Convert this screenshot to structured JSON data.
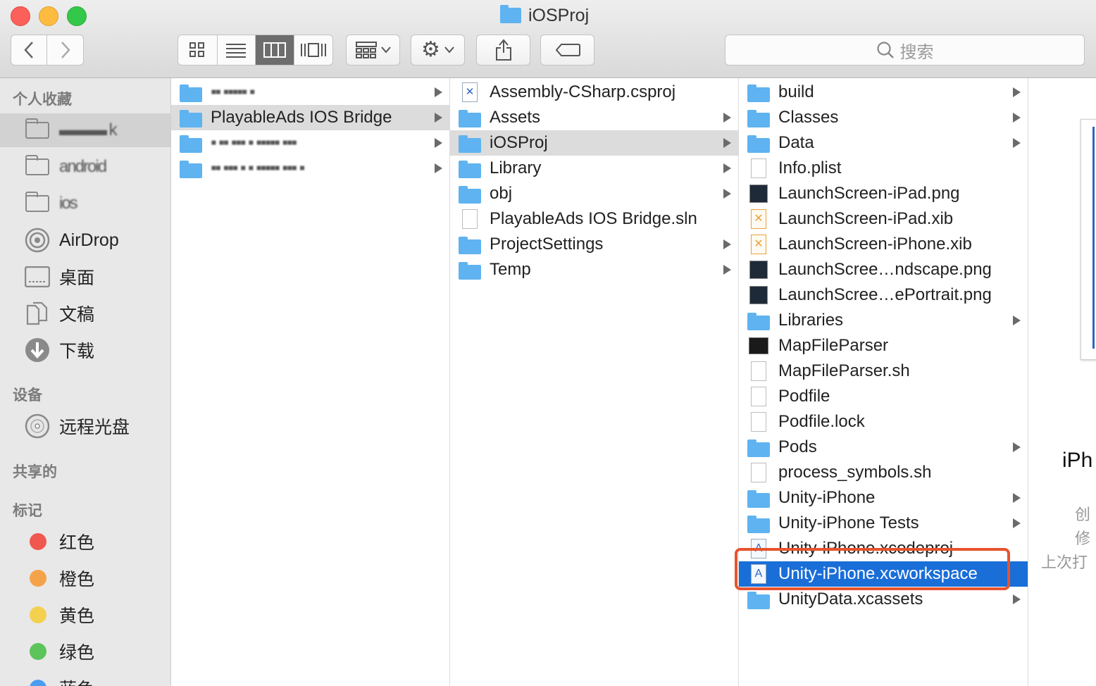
{
  "window": {
    "title": "iOSProj"
  },
  "toolbar": {
    "back_icon": "chevron-left-icon",
    "forward_icon": "chevron-right-icon",
    "view_modes": [
      "icon-view",
      "list-view",
      "column-view",
      "coverflow-view"
    ],
    "active_view": "column-view",
    "search_placeholder": "搜索"
  },
  "sidebar": {
    "sections": [
      {
        "title": "个人收藏",
        "items": [
          {
            "label": "▬▬▬ k",
            "icon": "folder-icon",
            "blurred": true,
            "selected": true
          },
          {
            "label": "android",
            "icon": "folder-icon",
            "blurred": true
          },
          {
            "label": "ios",
            "icon": "folder-icon",
            "blurred": true
          },
          {
            "label": "AirDrop",
            "icon": "airdrop-icon"
          },
          {
            "label": "桌面",
            "icon": "desktop-icon"
          },
          {
            "label": "文稿",
            "icon": "documents-icon"
          },
          {
            "label": "下载",
            "icon": "downloads-icon"
          }
        ]
      },
      {
        "title": "设备",
        "items": [
          {
            "label": "远程光盘",
            "icon": "disc-icon"
          }
        ]
      },
      {
        "title": "共享的",
        "items": []
      },
      {
        "title": "标记",
        "items": [
          {
            "label": "红色",
            "color": "#f0574f"
          },
          {
            "label": "橙色",
            "color": "#f5a34a"
          },
          {
            "label": "黄色",
            "color": "#f4d04f"
          },
          {
            "label": "绿色",
            "color": "#5cc45a"
          },
          {
            "label": "蓝色",
            "color": "#4c9df0"
          }
        ]
      }
    ]
  },
  "columns": [
    {
      "rows": [
        {
          "label": "▪▪ ▪▪▪▪▪ ▪",
          "type": "folder",
          "arrow": true,
          "blurred": true
        },
        {
          "label": "PlayableAds IOS Bridge",
          "type": "folder",
          "arrow": true,
          "selected": "gray"
        },
        {
          "label": "▪ ▪▪ ▪▪▪ ▪ ▪▪▪▪▪ ▪▪▪",
          "type": "folder",
          "arrow": true,
          "blurred": true
        },
        {
          "label": "▪▪ ▪▪▪ ▪ ▪ ▪▪▪▪▪ ▪▪▪ ▪",
          "type": "folder",
          "arrow": true,
          "blurred": true
        }
      ]
    },
    {
      "rows": [
        {
          "label": "Assembly-CSharp.csproj",
          "type": "csproj",
          "arrow": false
        },
        {
          "label": "Assets",
          "type": "folder",
          "arrow": true
        },
        {
          "label": "iOSProj",
          "type": "folder",
          "arrow": true,
          "selected": "gray"
        },
        {
          "label": "Library",
          "type": "folder",
          "arrow": true
        },
        {
          "label": "obj",
          "type": "folder",
          "arrow": true
        },
        {
          "label": "PlayableAds IOS Bridge.sln",
          "type": "doc",
          "arrow": false
        },
        {
          "label": "ProjectSettings",
          "type": "folder",
          "arrow": true
        },
        {
          "label": "Temp",
          "type": "folder",
          "arrow": true
        }
      ]
    },
    {
      "rows": [
        {
          "label": "build",
          "type": "folder",
          "arrow": true
        },
        {
          "label": "Classes",
          "type": "folder",
          "arrow": true
        },
        {
          "label": "Data",
          "type": "folder",
          "arrow": true
        },
        {
          "label": "Info.plist",
          "type": "doc",
          "arrow": false
        },
        {
          "label": "LaunchScreen-iPad.png",
          "type": "image",
          "arrow": false
        },
        {
          "label": "LaunchScreen-iPad.xib",
          "type": "xib",
          "arrow": false
        },
        {
          "label": "LaunchScreen-iPhone.xib",
          "type": "xib",
          "arrow": false
        },
        {
          "label": "LaunchScree…ndscape.png",
          "type": "image",
          "arrow": false
        },
        {
          "label": "LaunchScree…ePortrait.png",
          "type": "image",
          "arrow": false
        },
        {
          "label": "Libraries",
          "type": "folder",
          "arrow": true
        },
        {
          "label": "MapFileParser",
          "type": "exec",
          "arrow": false
        },
        {
          "label": "MapFileParser.sh",
          "type": "doc",
          "arrow": false
        },
        {
          "label": "Podfile",
          "type": "doc",
          "arrow": false
        },
        {
          "label": "Podfile.lock",
          "type": "doc",
          "arrow": false
        },
        {
          "label": "Pods",
          "type": "folder",
          "arrow": true
        },
        {
          "label": "process_symbols.sh",
          "type": "doc",
          "arrow": false
        },
        {
          "label": "Unity-iPhone",
          "type": "folder",
          "arrow": true
        },
        {
          "label": "Unity-iPhone Tests",
          "type": "folder",
          "arrow": true
        },
        {
          "label": "Unity-iPhone.xcodeproj",
          "type": "xcode",
          "arrow": false
        },
        {
          "label": "Unity-iPhone.xcworkspace",
          "type": "xcode",
          "arrow": false,
          "selected": "blue"
        },
        {
          "label": "UnityData.xcassets",
          "type": "folder",
          "arrow": true
        }
      ]
    }
  ],
  "preview": {
    "name_fragment": "iPh",
    "meta_fragments": [
      "创",
      "修",
      "上次打"
    ]
  }
}
